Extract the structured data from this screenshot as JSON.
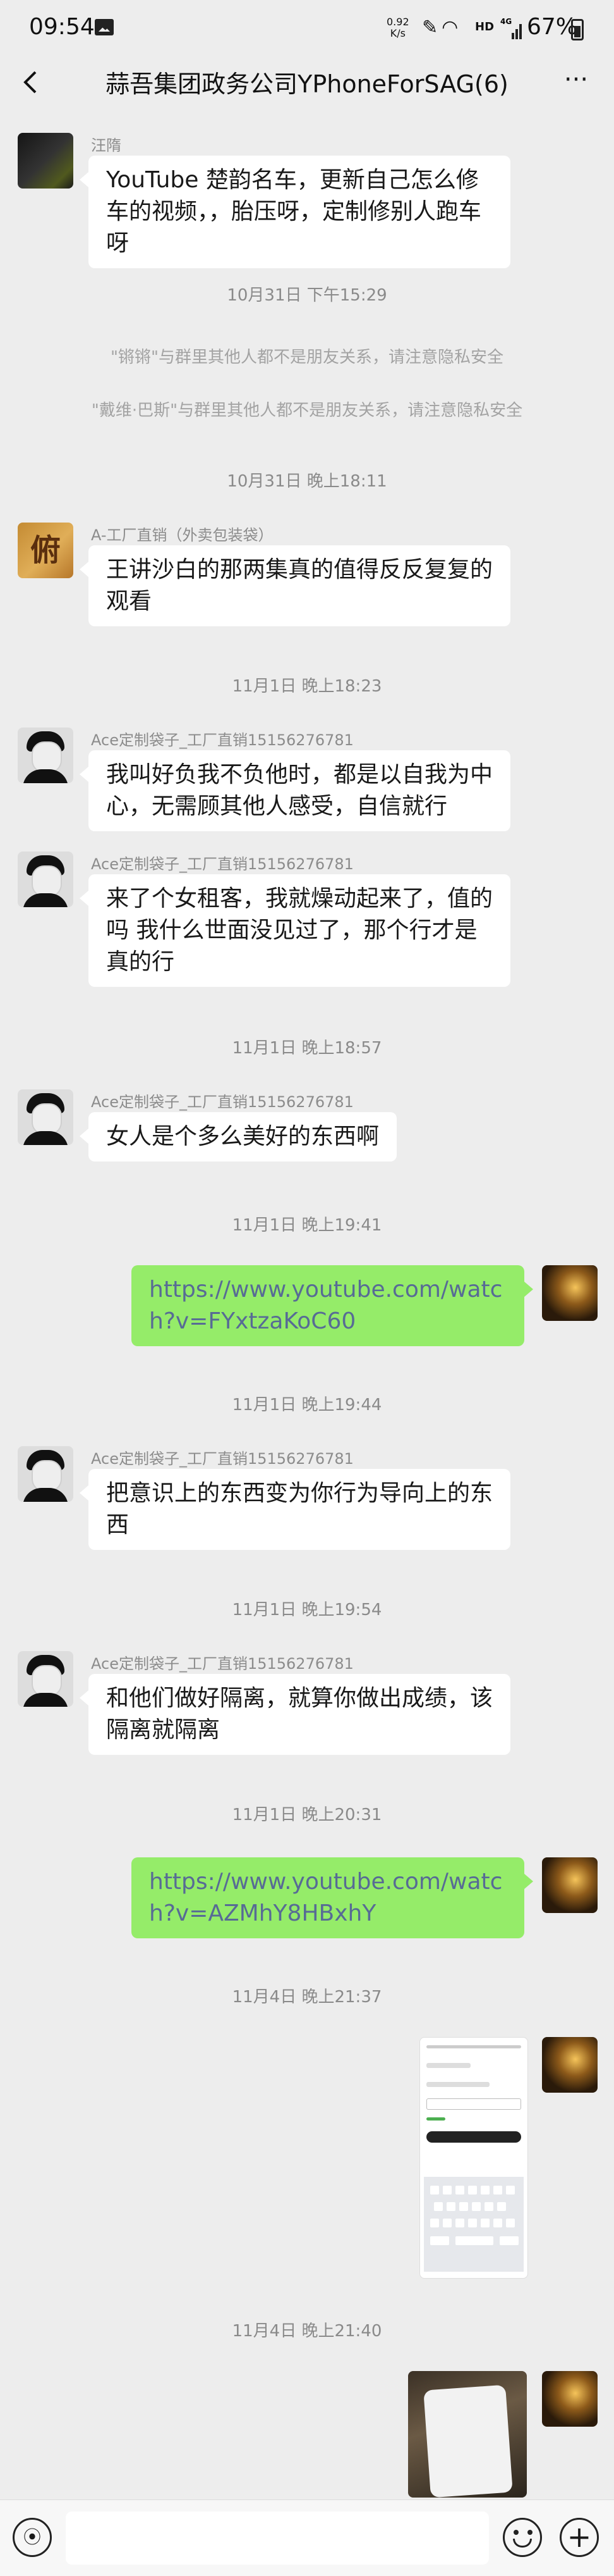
{
  "status_bar": {
    "time": "09:54",
    "net_speed_value": "0.92",
    "net_speed_unit": "K/s",
    "network_hd": "HD",
    "network_gen": "4G",
    "battery": "67%"
  },
  "header": {
    "title": "蒜吾集团政务公司YPhoneForSAG(6)",
    "more": "···"
  },
  "messages": {
    "m1": {
      "sender": "汪隋",
      "text": "YouTube 楚韵名车，更新自己怎么修车的视频，，胎压呀，定制修别人跑车呀"
    },
    "t1": "10月31日 下午15:29",
    "sys1": "\"锵锵\"与群里其他人都不是朋友关系，请注意隐私安全",
    "sys2": "\"戴维·巴斯\"与群里其他人都不是朋友关系，请注意隐私安全",
    "t2": "10月31日 晚上18:11",
    "m2": {
      "avatar_text": "俯",
      "sender": "A-工厂直销（外卖包装袋）",
      "text": "王讲沙白的那两集真的值得反反复复的观看"
    },
    "t3": "11月1日 晚上18:23",
    "m3": {
      "sender": "Ace定制袋子_工厂直销15156276781",
      "text": "我叫好负我不负他时，都是以自我为中心，无需顾其他人感受，自信就行"
    },
    "m4": {
      "sender": "Ace定制袋子_工厂直销15156276781",
      "text": "来了个女租客，我就燥动起来了，值的吗 我什么世面没见过了，那个行才是真的行"
    },
    "t4": "11月1日 晚上18:57",
    "m5": {
      "sender": "Ace定制袋子_工厂直销15156276781",
      "text": "女人是个多么美好的东西啊"
    },
    "t5": "11月1日 晚上19:41",
    "m6": {
      "link": "https://www.youtube.com/watch?v=FYxtzaKoC60"
    },
    "t6": "11月1日 晚上19:44",
    "m7": {
      "sender": "Ace定制袋子_工厂直销15156276781",
      "text": "把意识上的东西变为你行为导向上的东西"
    },
    "t7": "11月1日 晚上19:54",
    "m8": {
      "sender": "Ace定制袋子_工厂直销15156276781",
      "text": "和他们做好隔离，就算你做出成绩，该隔离就隔离"
    },
    "t8": "11月1日 晚上20:31",
    "m9": {
      "link": "https://www.youtube.com/watch?v=AZMhY8HBxhY"
    },
    "t9": "11月4日 晚上21:37",
    "t10": "11月4日 晚上21:40"
  },
  "bottom_bar": {
    "voice_icon": "voice-icon",
    "emoji_icon": "emoji-icon",
    "plus_icon": "plus-icon"
  },
  "colors": {
    "background": "#ededed",
    "outgoing_bubble": "#95ec69",
    "incoming_bubble": "#ffffff",
    "link": "#576b95",
    "timestamp": "#8a8a8a"
  }
}
